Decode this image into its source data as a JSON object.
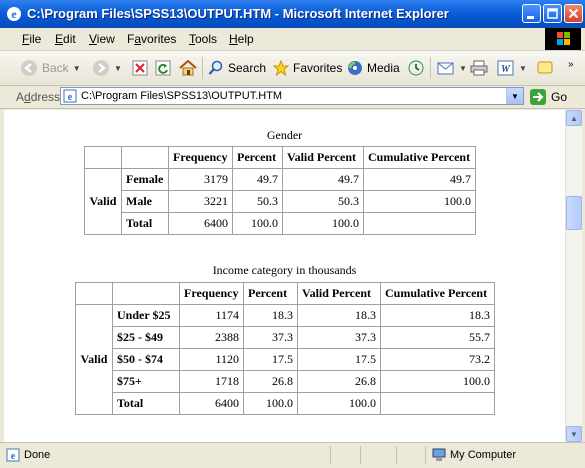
{
  "window": {
    "title": "C:\\Program Files\\SPSS13\\OUTPUT.HTM - Microsoft Internet Explorer"
  },
  "menu": {
    "items": [
      {
        "u": "F",
        "rest": "ile"
      },
      {
        "u": "E",
        "rest": "dit"
      },
      {
        "u": "V",
        "rest": "iew"
      },
      {
        "pre": "F",
        "u": "a",
        "rest": "vorites"
      },
      {
        "u": "T",
        "rest": "ools"
      },
      {
        "u": "H",
        "rest": "elp"
      }
    ]
  },
  "toolbar": {
    "back_label": "Back",
    "search_label": "Search",
    "favorites_label": "Favorites",
    "media_label": "Media"
  },
  "address": {
    "label_u": "d",
    "label_pre": "A",
    "label_rest": "dress",
    "url": "C:\\Program Files\\SPSS13\\OUTPUT.HTM",
    "go_label": "Go"
  },
  "gender": {
    "title": "Gender",
    "headers": [
      "Frequency",
      "Percent",
      "Valid Percent",
      "Cumulative Percent"
    ],
    "group_label": "Valid",
    "rows": [
      {
        "label": "Female",
        "values": [
          "3179",
          "49.7",
          "49.7",
          "49.7"
        ]
      },
      {
        "label": "Male",
        "values": [
          "3221",
          "50.3",
          "50.3",
          "100.0"
        ]
      },
      {
        "label": "Total",
        "values": [
          "6400",
          "100.0",
          "100.0",
          ""
        ]
      }
    ]
  },
  "income": {
    "title": "Income category in thousands",
    "headers": [
      "Frequency",
      "Percent",
      "Valid Percent",
      "Cumulative Percent"
    ],
    "group_label": "Valid",
    "rows": [
      {
        "label": "Under $25",
        "values": [
          "1174",
          "18.3",
          "18.3",
          "18.3"
        ]
      },
      {
        "label": "$25 - $49",
        "values": [
          "2388",
          "37.3",
          "37.3",
          "55.7"
        ]
      },
      {
        "label": "$50 - $74",
        "values": [
          "1120",
          "17.5",
          "17.5",
          "73.2"
        ]
      },
      {
        "label": "$75+",
        "values": [
          "1718",
          "26.8",
          "26.8",
          "100.0"
        ]
      },
      {
        "label": "Total",
        "values": [
          "6400",
          "100.0",
          "100.0",
          ""
        ]
      }
    ]
  },
  "status": {
    "left": "Done",
    "right": "My Computer"
  }
}
